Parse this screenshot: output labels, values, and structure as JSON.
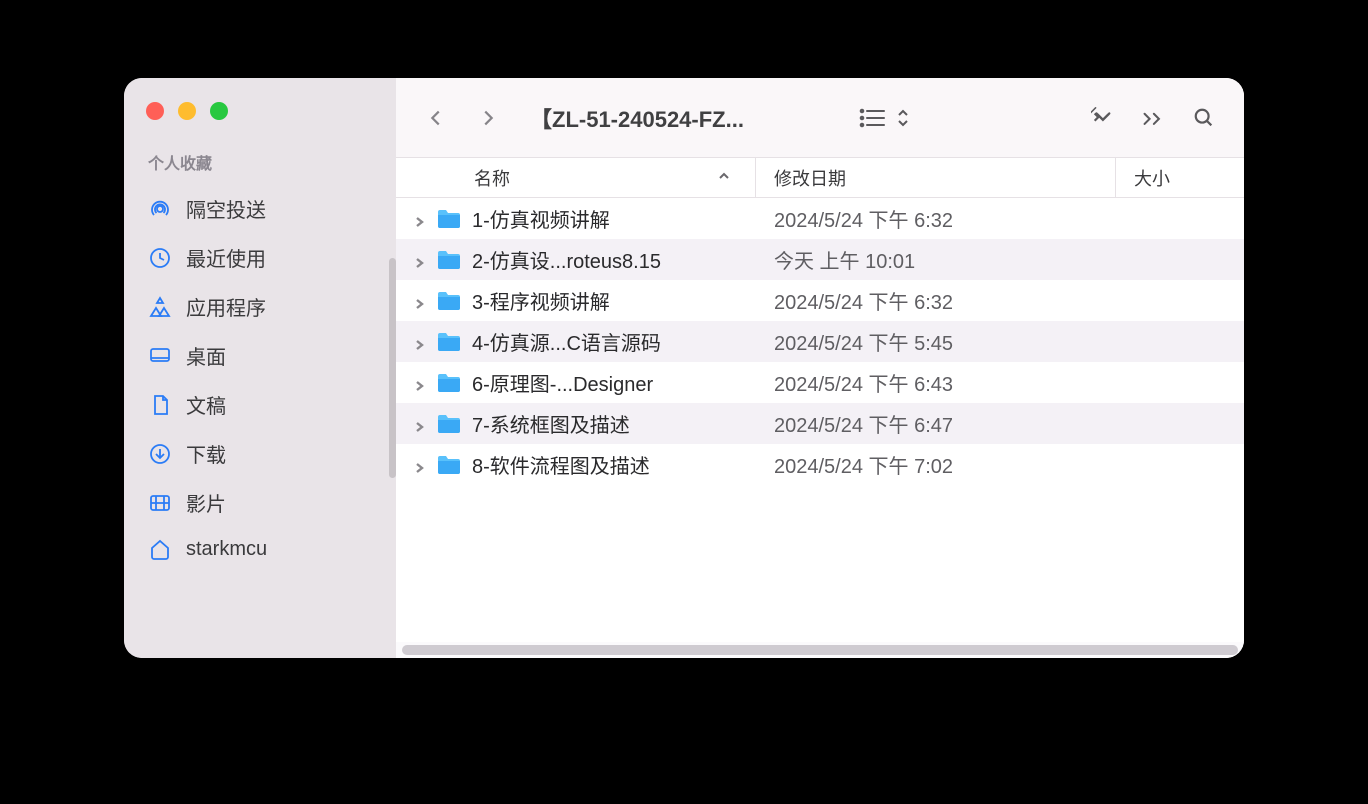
{
  "window_title": "【ZL-51-240524-FZ...",
  "sidebar": {
    "section": "个人收藏",
    "items": [
      {
        "label": "隔空投送",
        "icon": "airdrop"
      },
      {
        "label": "最近使用",
        "icon": "clock"
      },
      {
        "label": "应用程序",
        "icon": "apps"
      },
      {
        "label": "桌面",
        "icon": "desktop"
      },
      {
        "label": "文稿",
        "icon": "doc"
      },
      {
        "label": "下载",
        "icon": "download"
      },
      {
        "label": "影片",
        "icon": "film"
      },
      {
        "label": "starkmcu",
        "icon": "home"
      }
    ]
  },
  "columns": {
    "name": "名称",
    "date": "修改日期",
    "size": "大小"
  },
  "files": [
    {
      "name": "1-仿真视频讲解",
      "date": "2024/5/24 下午 6:32"
    },
    {
      "name": "2-仿真设...roteus8.15",
      "date": "今天 上午 10:01"
    },
    {
      "name": "3-程序视频讲解",
      "date": "2024/5/24 下午 6:32"
    },
    {
      "name": "4-仿真源...C语言源码",
      "date": "2024/5/24 下午 5:45"
    },
    {
      "name": "6-原理图-...Designer",
      "date": "2024/5/24 下午 6:43"
    },
    {
      "name": "7-系统框图及描述",
      "date": "2024/5/24 下午 6:47"
    },
    {
      "name": "8-软件流程图及描述",
      "date": "2024/5/24 下午 7:02"
    }
  ]
}
